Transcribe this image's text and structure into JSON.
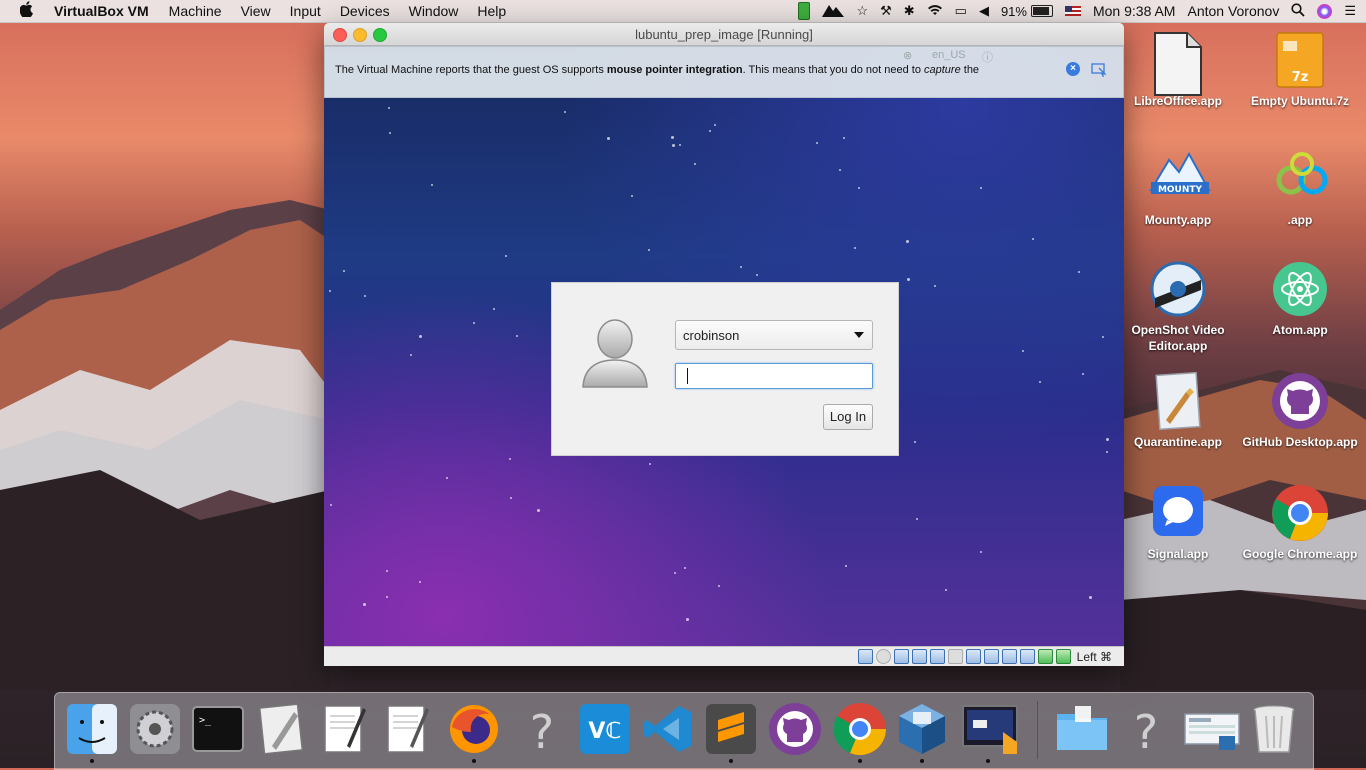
{
  "menubar": {
    "apple": "",
    "app_name": "VirtualBox VM",
    "menus": [
      "Machine",
      "View",
      "Input",
      "Devices",
      "Window",
      "Help"
    ],
    "battery_percent": "91%",
    "clock": "Mon 9:38 AM",
    "user": "Anton Voronov",
    "battery_level": 0.91
  },
  "window": {
    "title": "lubuntu_prep_image [Running]",
    "notice_pre": "The Virtual Machine reports that the guest OS supports ",
    "notice_bold": "mouse pointer integration",
    "notice_mid": ". This means that you do not need to ",
    "notice_italic": "capture",
    "notice_post": " the",
    "notice_ghost_locale": "en_US"
  },
  "login": {
    "username": "crobinson",
    "password": "",
    "button": "Log In"
  },
  "status_bar": {
    "host_key": "Left ⌘"
  },
  "desktop_icons": [
    {
      "label": "LibreOffice.app",
      "icon": "libreoffice-doc-icon"
    },
    {
      "label": "Empty Ubuntu.7z",
      "icon": "7z-archive-icon"
    },
    {
      "label": "Mounty.app",
      "icon": "mounty-icon"
    },
    {
      "label": ".app",
      "icon": "rings-app-icon"
    },
    {
      "label": "OpenShot Video Editor.app",
      "icon": "openshot-icon"
    },
    {
      "label": "Atom.app",
      "icon": "atom-icon"
    },
    {
      "label": "Quarantine.app",
      "icon": "quarantine-script-icon"
    },
    {
      "label": "GitHub Desktop.app",
      "icon": "github-icon"
    },
    {
      "label": "Signal.app",
      "icon": "signal-icon"
    },
    {
      "label": "Google Chrome.app",
      "icon": "chrome-icon"
    }
  ],
  "dock": [
    "finder-icon",
    "system-preferences-icon",
    "terminal-icon",
    "script-editor-icon",
    "textedit-icon",
    "textedit-icon-2",
    "firefox-icon",
    "question-mark-icon",
    "vnc-viewer-icon",
    "vscode-icon",
    "sublime-text-icon",
    "github-desktop-icon",
    "chrome-icon",
    "virtualbox-icon",
    "virtualbox-vm-icon",
    "downloads-folder-icon",
    "question-mark-icon-2",
    "screenshot-icon",
    "trash-icon"
  ],
  "colors": {
    "accent": "#3a7be0",
    "vm_bg_top": "#17285f",
    "vm_bg_bottom": "#54309a"
  }
}
